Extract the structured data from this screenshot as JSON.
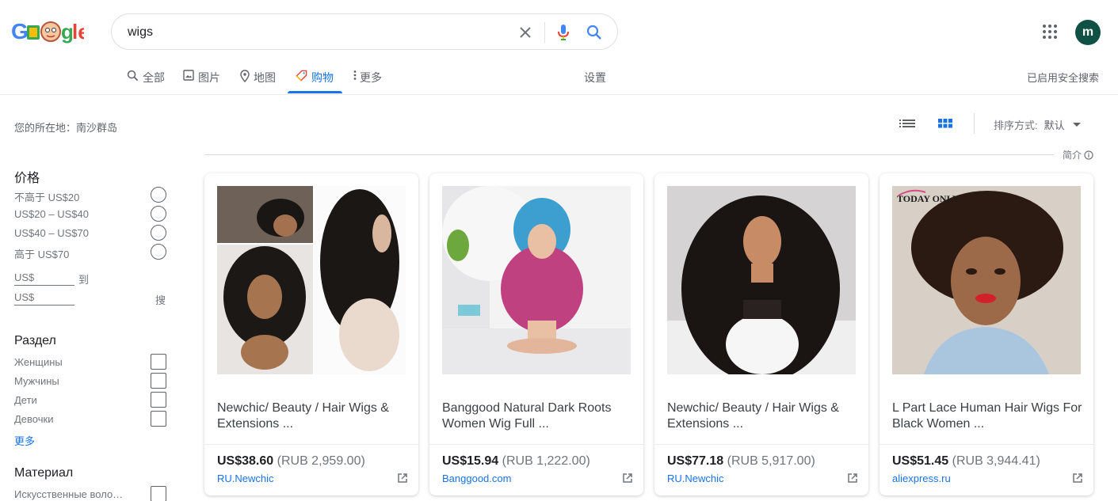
{
  "search": {
    "query": "wigs"
  },
  "user": {
    "avatar_letter": "m"
  },
  "tabs": [
    {
      "label": "全部",
      "icon": "search-icon"
    },
    {
      "label": "图片",
      "icon": "image-icon"
    },
    {
      "label": "地图",
      "icon": "map-pin-icon"
    },
    {
      "label": "购物",
      "icon": "tag-icon",
      "active": true
    },
    {
      "label": "更多",
      "icon": "more-vert-icon"
    }
  ],
  "settings_label": "设置",
  "safesearch_label": "已启用安全搜索",
  "location_text": "您的所在地：南沙群岛",
  "filters": {
    "price": {
      "title": "价格",
      "options": [
        "不高于 US$20",
        "US$20 – US$40",
        "US$40 – US$70",
        "高于 US$70"
      ],
      "min_placeholder": "US$",
      "max_placeholder": "US$",
      "to_label": "到",
      "go_label": "搜"
    },
    "section": {
      "title": "Раздел",
      "options": [
        "Женщины",
        "Мужчины",
        "Дети",
        "Девочки"
      ],
      "more_label": "更多"
    },
    "material": {
      "title": "Материал",
      "options": [
        "Искусственные воло…"
      ]
    }
  },
  "toolbar": {
    "sort_label": "排序方式:",
    "sort_value": "默认",
    "about_label": "简介"
  },
  "products": [
    {
      "title": "Newchic/ Beauty / Hair Wigs & Extensions ...",
      "price": "US$38.60",
      "alt_price": "(RUB 2,959.00)",
      "seller": "RU.Newchic"
    },
    {
      "title": "Banggood Natural Dark Roots Women Wig Full ...",
      "price": "US$15.94",
      "alt_price": "(RUB 1,222.00)",
      "seller": "Banggood.com"
    },
    {
      "title": "Newchic/ Beauty / Hair Wigs & Extensions ...",
      "price": "US$77.18",
      "alt_price": "(RUB 5,917.00)",
      "seller": "RU.Newchic"
    },
    {
      "title": "L Part Lace Human Hair Wigs For Black Women ...",
      "price": "US$51.45",
      "alt_price": "(RUB 3,944.41)",
      "seller": "aliexpress.ru",
      "image_caption": "TODAY ONLY"
    }
  ],
  "colors": {
    "accent": "#1a73e8",
    "avatar_bg": "#0f5144"
  }
}
